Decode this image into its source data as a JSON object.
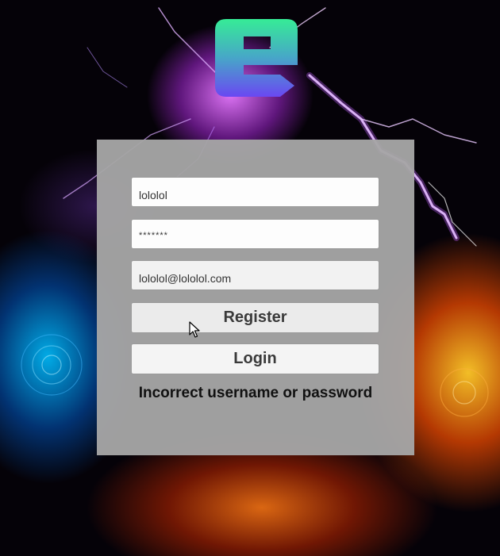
{
  "form": {
    "username_value": "lololol",
    "password_value": "*******",
    "email_value": "lololol@lololol.com"
  },
  "buttons": {
    "register_label": "Register",
    "login_label": "Login"
  },
  "status": {
    "error_message": "Incorrect username or password"
  },
  "icons": {
    "logo": "e-letter-logo-icon",
    "cursor": "mouse-pointer-icon"
  },
  "colors": {
    "panel_background": "#a5a5a5",
    "logo_top": "#35e89a",
    "logo_bottom": "#6a4cf0",
    "text": "#3a3a3a",
    "error_text": "#111111"
  }
}
